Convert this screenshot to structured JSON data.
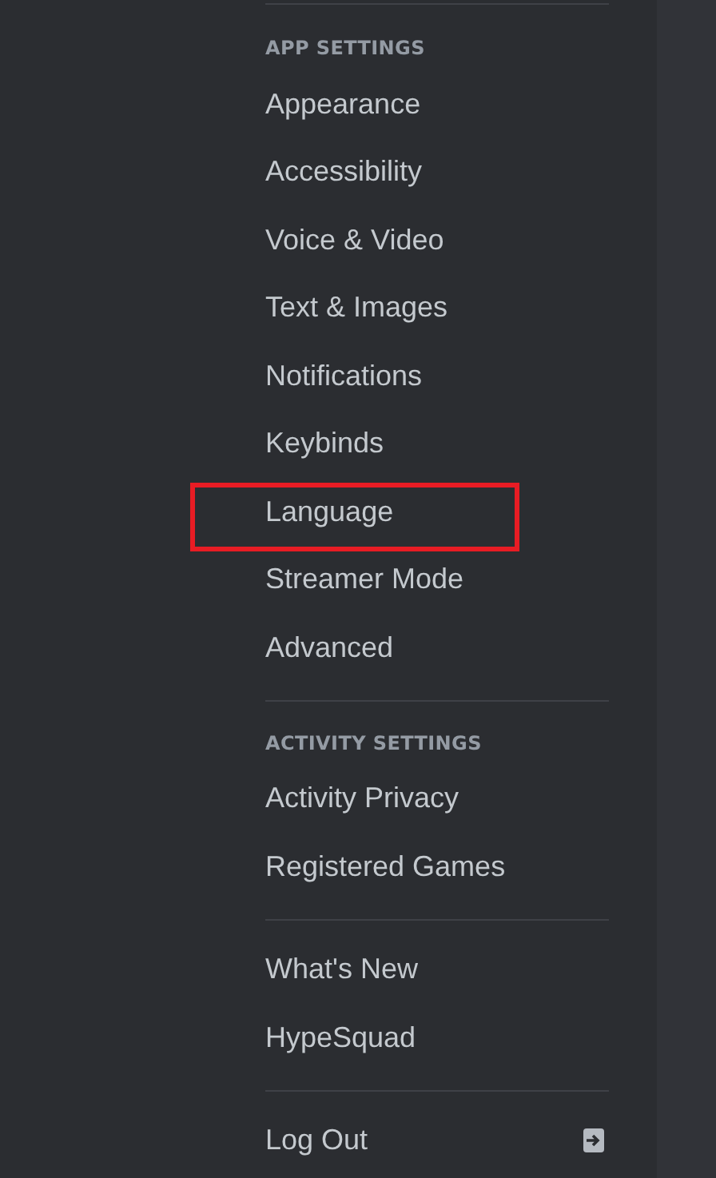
{
  "sections": [
    {
      "header": "APP SETTINGS",
      "items": [
        {
          "label": "Appearance",
          "highlighted": false
        },
        {
          "label": "Accessibility",
          "highlighted": false
        },
        {
          "label": "Voice & Video",
          "highlighted": false
        },
        {
          "label": "Text & Images",
          "highlighted": false
        },
        {
          "label": "Notifications",
          "highlighted": false
        },
        {
          "label": "Keybinds",
          "highlighted": false
        },
        {
          "label": "Language",
          "highlighted": true
        },
        {
          "label": "Streamer Mode",
          "highlighted": false
        },
        {
          "label": "Advanced",
          "highlighted": false
        }
      ]
    },
    {
      "header": "ACTIVITY SETTINGS",
      "items": [
        {
          "label": "Activity Privacy",
          "highlighted": false
        },
        {
          "label": "Registered Games",
          "highlighted": false
        }
      ]
    },
    {
      "items": [
        {
          "label": "What's New",
          "highlighted": false
        },
        {
          "label": "HypeSquad",
          "highlighted": false
        }
      ]
    },
    {
      "items": [
        {
          "label": "Log Out",
          "highlighted": false,
          "kind": "logout"
        }
      ]
    }
  ]
}
